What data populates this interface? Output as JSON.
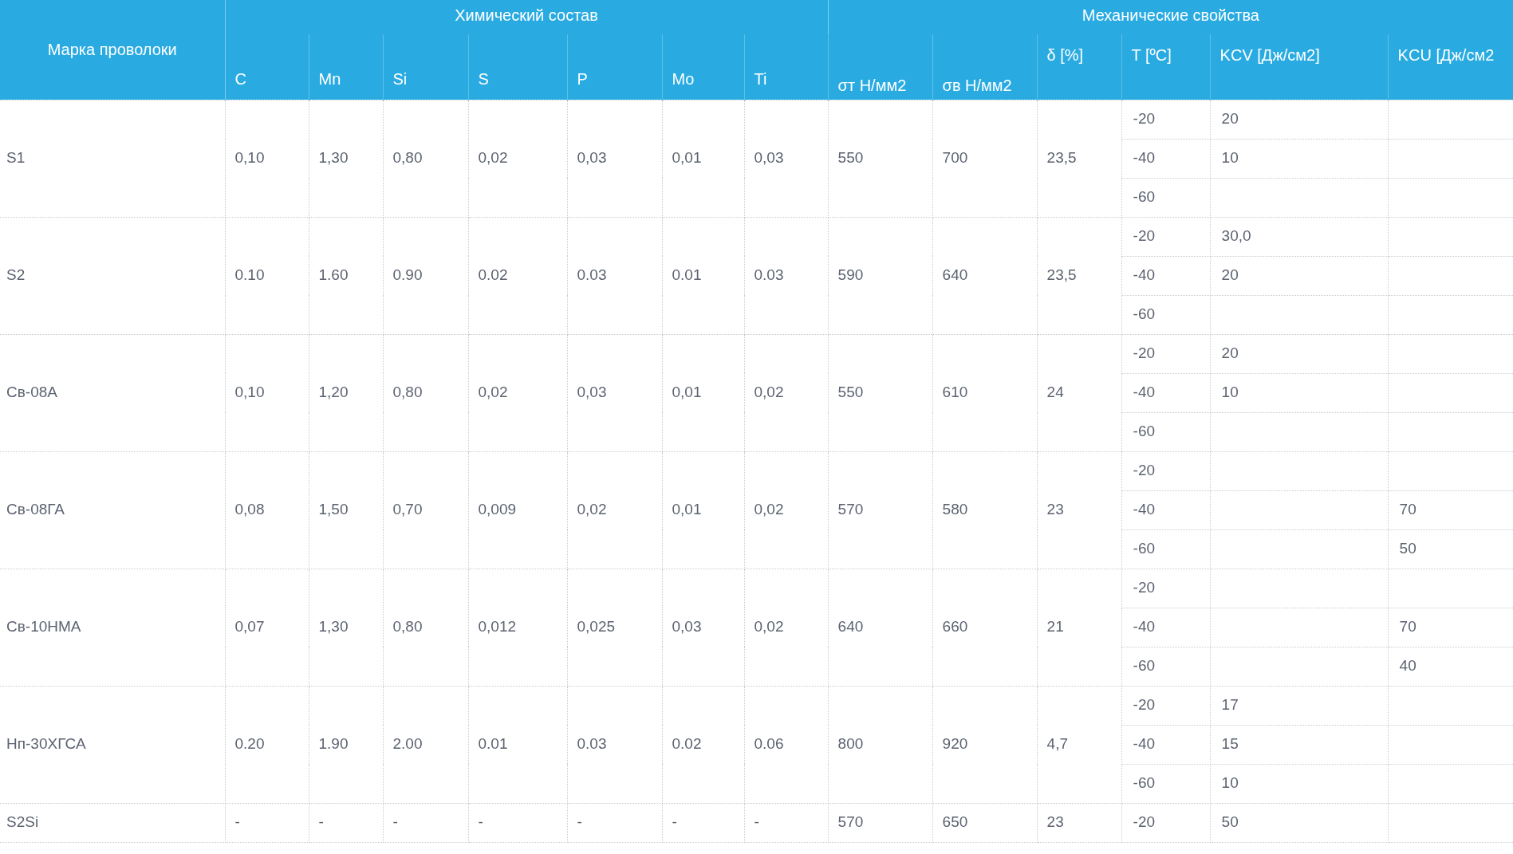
{
  "table": {
    "grade_header": "Марка проволоки",
    "groups": [
      {
        "label": "Химический состав",
        "columns": [
          "C",
          "Mn",
          "Si",
          "S",
          "P",
          "Mo",
          "Ti"
        ]
      },
      {
        "label": "Механические свойства",
        "columns": [
          "σт Н/мм2",
          "σв Н/мм2",
          "δ [%]",
          "T [ºC]",
          "KCV [Дж/см2]",
          "KCU [Дж/см2"
        ]
      }
    ],
    "rows": [
      {
        "grade": "S1",
        "values": [
          "0,10",
          "1,30",
          "0,80",
          "0,02",
          "0,03",
          "0,01",
          "0,03",
          "550",
          "700",
          "23,5"
        ],
        "impacts": [
          {
            "t": "-20",
            "kcv": "20"
          },
          {
            "t": "-40",
            "kcv": "10"
          },
          {
            "t": "-60"
          }
        ]
      },
      {
        "grade": "S2",
        "values": [
          "0.10",
          "1.60",
          "0.90",
          "0.02",
          "0.03",
          "0.01",
          "0.03",
          "590",
          "640",
          "23,5"
        ],
        "impacts": [
          {
            "t": "-20",
            "kcv": "30,0"
          },
          {
            "t": "-40",
            "kcv": "20"
          },
          {
            "t": "-60"
          }
        ]
      },
      {
        "grade": "Св-08А",
        "values": [
          "0,10",
          "1,20",
          "0,80",
          "0,02",
          "0,03",
          "0,01",
          "0,02",
          "550",
          "610",
          "24"
        ],
        "impacts": [
          {
            "t": "-20",
            "kcv": "20"
          },
          {
            "t": "-40",
            "kcv": "10"
          },
          {
            "t": "-60"
          }
        ]
      },
      {
        "grade": "Св-08ГА",
        "values": [
          "0,08",
          "1,50",
          "0,70",
          "0,009",
          "0,02",
          "0,01",
          "0,02",
          "570",
          "580",
          "23"
        ],
        "impacts": [
          {
            "t": "-20"
          },
          {
            "t": "-40",
            "kcu": "70"
          },
          {
            "t": "-60",
            "kcu": "50"
          }
        ]
      },
      {
        "grade": "Св-10НМА",
        "values": [
          "0,07",
          "1,30",
          "0,80",
          "0,012",
          "0,025",
          "0,03",
          "0,02",
          "640",
          "660",
          "21"
        ],
        "impacts": [
          {
            "t": "-20"
          },
          {
            "t": "-40",
            "kcu": "70"
          },
          {
            "t": "-60",
            "kcu": "40"
          }
        ]
      },
      {
        "grade": "Нп-30ХГСА",
        "values": [
          "0.20",
          "1.90",
          "2.00",
          "0.01",
          "0.03",
          "0.02",
          "0.06",
          "800",
          "920",
          "4,7"
        ],
        "impacts": [
          {
            "t": "-20",
            "kcv": "17"
          },
          {
            "t": "-40",
            "kcv": "15"
          },
          {
            "t": "-60",
            "kcv": "10"
          }
        ]
      },
      {
        "grade": "S2Si",
        "values": [
          "-",
          "-",
          "-",
          "-",
          "-",
          "-",
          "-",
          "570",
          "650",
          "23"
        ],
        "impacts": [
          {
            "t": "-20",
            "kcv": "50"
          }
        ]
      }
    ]
  }
}
